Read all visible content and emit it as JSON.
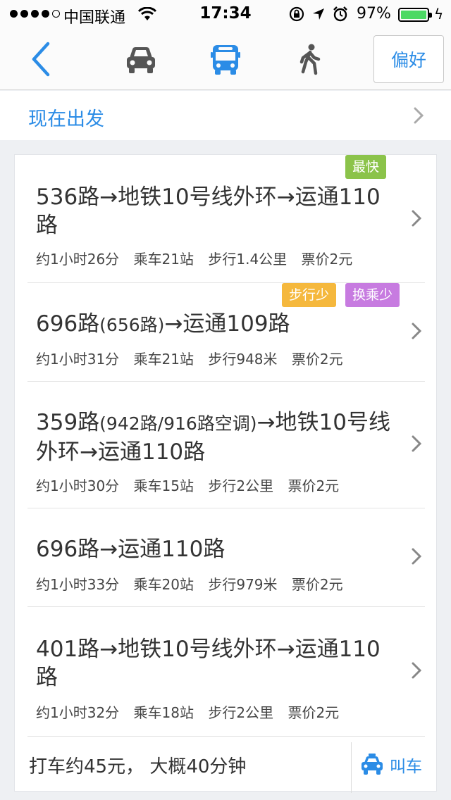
{
  "status_bar": {
    "carrier": "中国联通",
    "time": "17:34",
    "battery": "97%"
  },
  "nav": {
    "back_icon": "chevron-left-icon",
    "modes": [
      {
        "icon": "car-icon",
        "active": false
      },
      {
        "icon": "bus-icon",
        "active": true
      },
      {
        "icon": "walk-icon",
        "active": false
      }
    ],
    "preference_label": "偏好"
  },
  "depart": {
    "label": "现在出发"
  },
  "routes": [
    {
      "title": "536路→地铁10号线外环→运通110路",
      "tags": [
        "最快"
      ],
      "duration": "约1小时26分",
      "stops": "乘车21站",
      "walk": "步行1.4公里",
      "fare": "票价2元"
    },
    {
      "title_main": "696路",
      "title_alt": "(656路)",
      "title_rest": "→运通109路",
      "tags": [
        "步行少",
        "换乘少"
      ],
      "duration": "约1小时31分",
      "stops": "乘车21站",
      "walk": "步行948米",
      "fare": "票价2元"
    },
    {
      "title_main": "359路",
      "title_alt": "(942路/916路空调)",
      "title_rest": "→地铁10号线外环→运通110路",
      "tags": [],
      "duration": "约1小时30分",
      "stops": "乘车15站",
      "walk": "步行2公里",
      "fare": "票价2元"
    },
    {
      "title": "696路→运通110路",
      "tags": [],
      "duration": "约1小时33分",
      "stops": "乘车20站",
      "walk": "步行979米",
      "fare": "票价2元"
    },
    {
      "title": "401路→地铁10号线外环→运通110路",
      "tags": [],
      "duration": "约1小时32分",
      "stops": "乘车18站",
      "walk": "步行2公里",
      "fare": "票价2元"
    }
  ],
  "taxi": {
    "summary": "打车约45元， 大概40分钟",
    "button_label": "叫车",
    "icon": "taxi-icon"
  },
  "colors": {
    "accent": "#2b8ce6",
    "tag_fastest": "#8bc34a",
    "tag_less_walk": "#f5b83d",
    "tag_less_transfer": "#c77be0"
  }
}
